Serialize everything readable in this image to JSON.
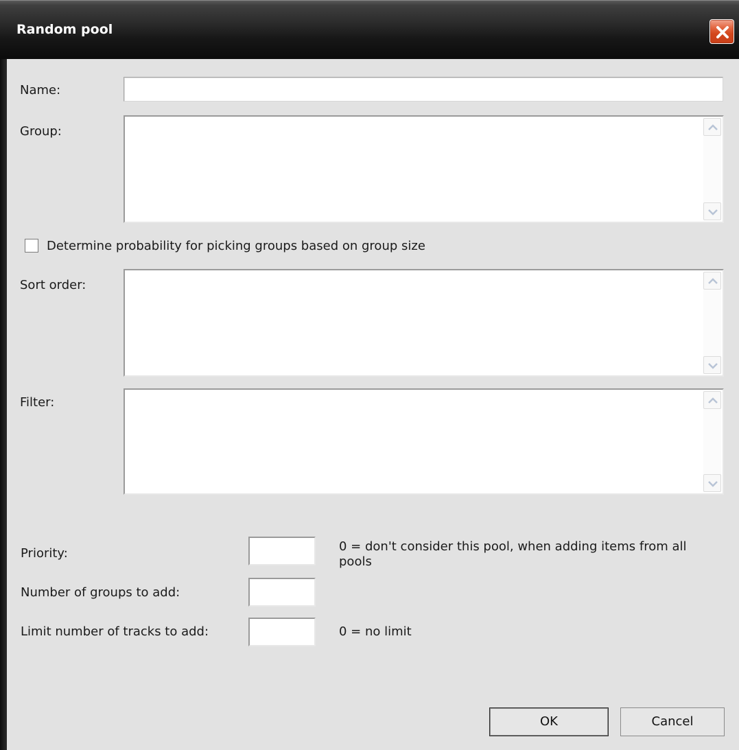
{
  "window": {
    "title": "Random pool"
  },
  "form": {
    "name_label": "Name:",
    "name_value": "",
    "group_label": "Group:",
    "group_value": "",
    "group_size_checkbox_label": "Determine probability for picking groups based on group size",
    "group_size_checked": false,
    "sort_order_label": "Sort order:",
    "sort_order_value": "",
    "filter_label": "Filter:",
    "filter_value": "",
    "priority_label": "Priority:",
    "priority_value": "",
    "priority_hint": "0 = don't consider this pool, when adding items from all pools",
    "groups_label": "Number of groups to add:",
    "groups_value": "",
    "limit_label": "Limit number of tracks to add:",
    "limit_value": "",
    "limit_hint": "0 = no limit"
  },
  "buttons": {
    "ok": "OK",
    "cancel": "Cancel"
  },
  "icons": {
    "close": "close-icon",
    "scroll_up": "chevron-up-icon",
    "scroll_down": "chevron-down-icon"
  }
}
